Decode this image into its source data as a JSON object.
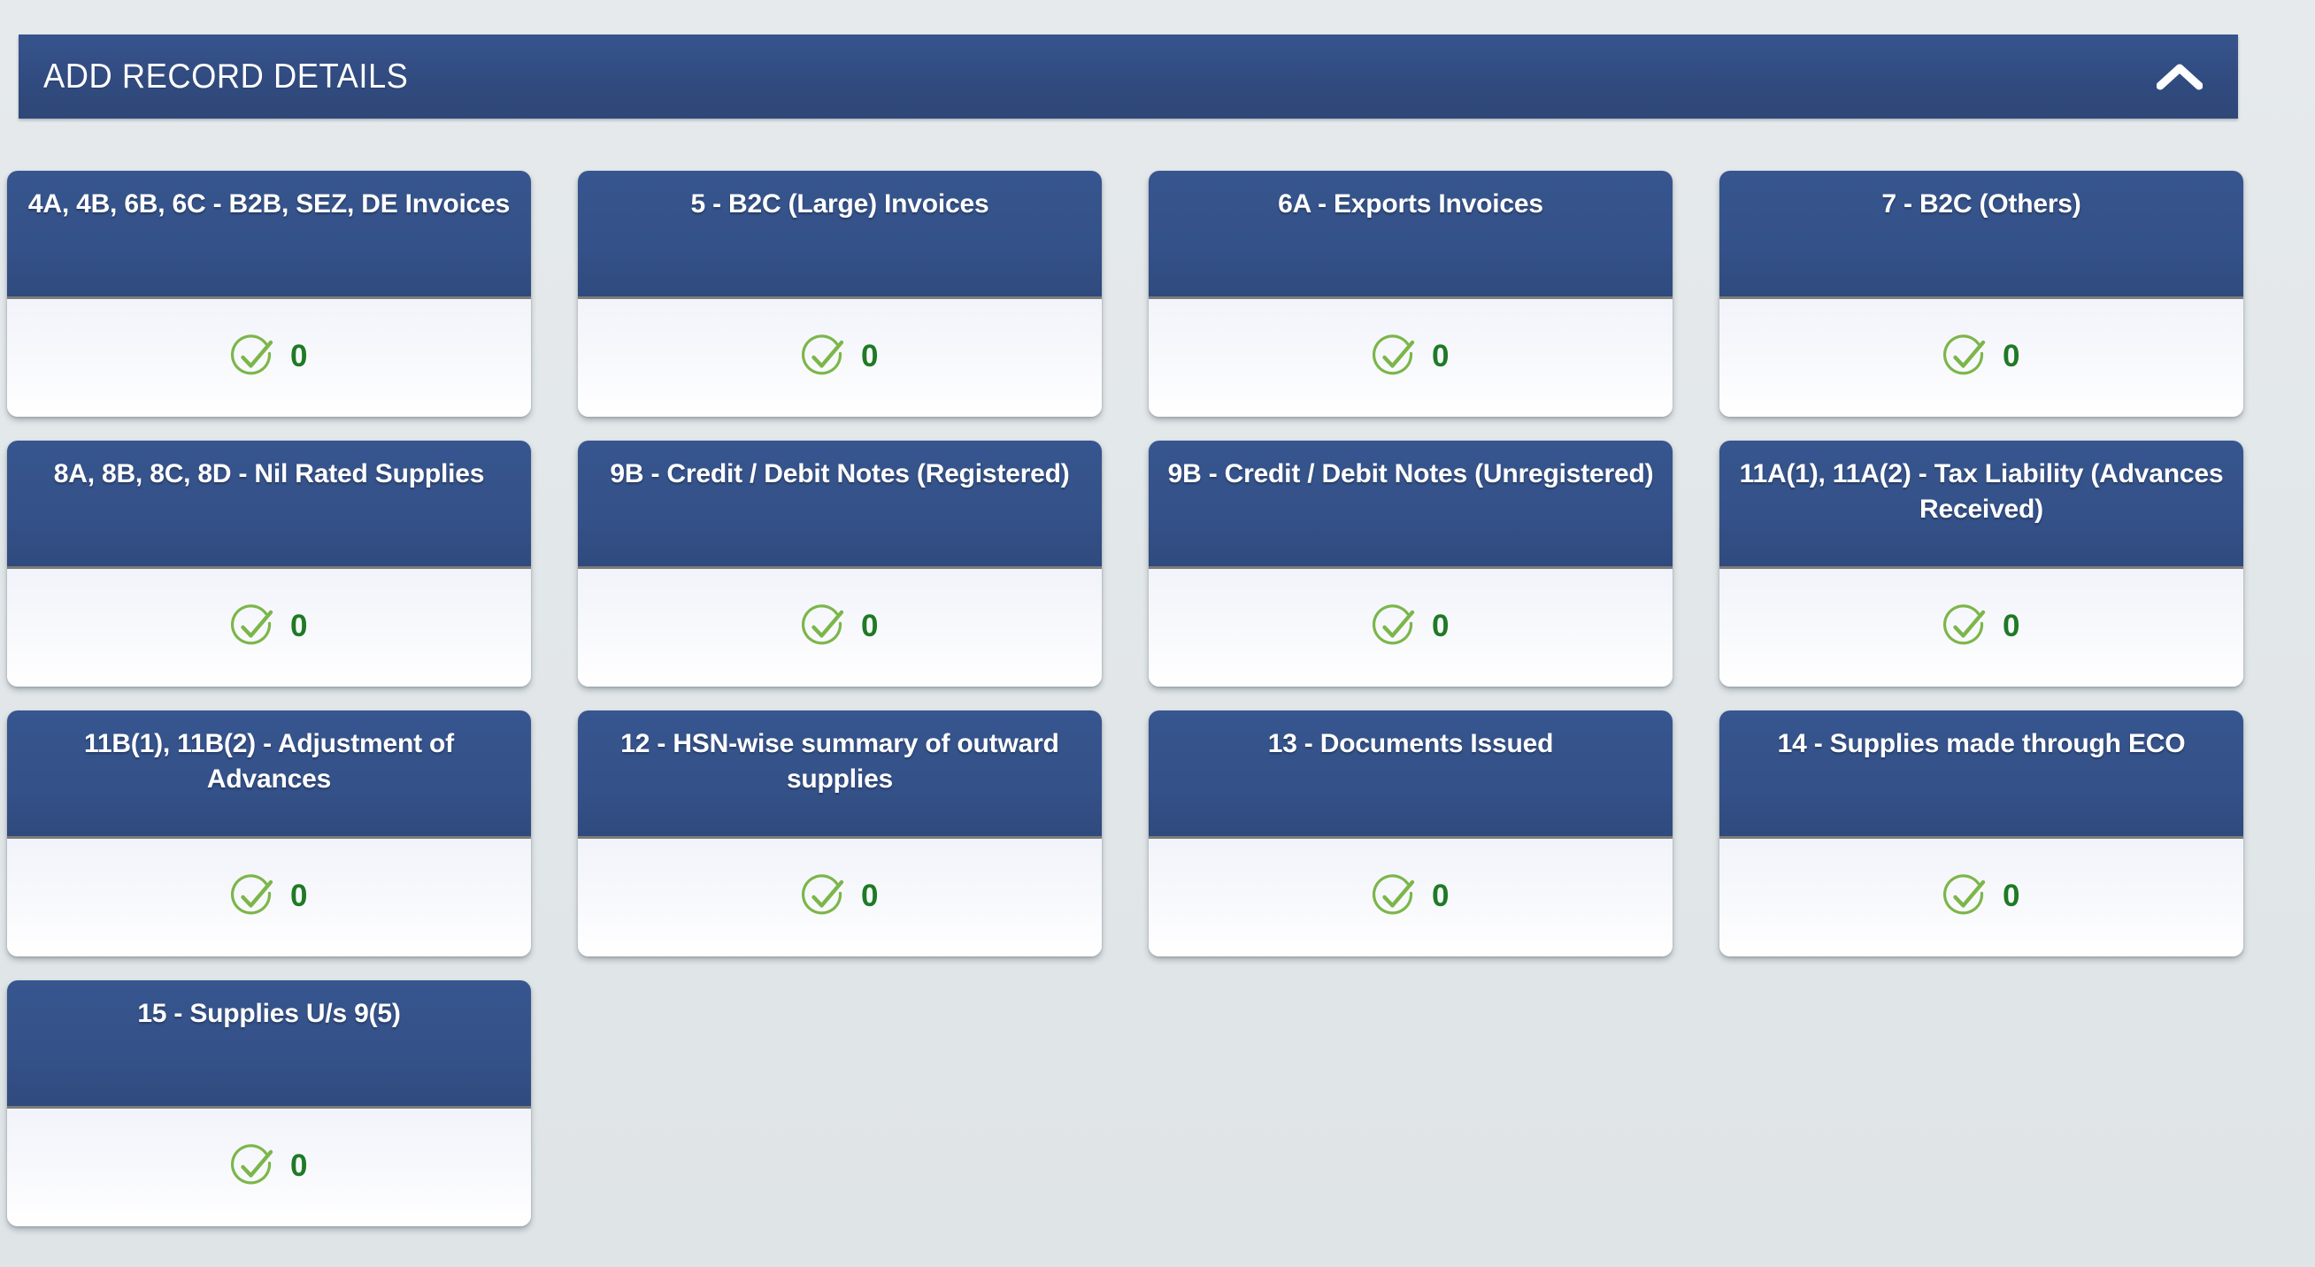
{
  "section": {
    "title": "ADD RECORD DETAILS",
    "collapse_icon": "chevron-up-icon",
    "expanded": true,
    "header_bg": "#33508a",
    "header_text_color": "#ffffff"
  },
  "theme": {
    "page_bg": "#e4e8ea",
    "card_header_bg": "#33508a",
    "card_body_bg": "#f7f8fc",
    "check_icon_color": "#7cb64a",
    "count_color": "#1f7a26"
  },
  "cards": [
    {
      "title": "4A, 4B, 6B, 6C - B2B, SEZ, DE Invoices",
      "count": "0",
      "status_icon": "check-circle-icon"
    },
    {
      "title": "5 - B2C (Large) Invoices",
      "count": "0",
      "status_icon": "check-circle-icon"
    },
    {
      "title": "6A - Exports Invoices",
      "count": "0",
      "status_icon": "check-circle-icon"
    },
    {
      "title": "7 - B2C (Others)",
      "count": "0",
      "status_icon": "check-circle-icon"
    },
    {
      "title": "8A, 8B, 8C, 8D - Nil Rated Supplies",
      "count": "0",
      "status_icon": "check-circle-icon"
    },
    {
      "title": "9B - Credit / Debit Notes (Registered)",
      "count": "0",
      "status_icon": "check-circle-icon"
    },
    {
      "title": "9B - Credit / Debit Notes (Unregistered)",
      "count": "0",
      "status_icon": "check-circle-icon"
    },
    {
      "title": "11A(1), 11A(2) - Tax Liability (Advances Received)",
      "count": "0",
      "status_icon": "check-circle-icon"
    },
    {
      "title": "11B(1), 11B(2) - Adjustment of Advances",
      "count": "0",
      "status_icon": "check-circle-icon"
    },
    {
      "title": "12 - HSN-wise summary of outward supplies",
      "count": "0",
      "status_icon": "check-circle-icon"
    },
    {
      "title": "13 - Documents Issued",
      "count": "0",
      "status_icon": "check-circle-icon"
    },
    {
      "title": "14 - Supplies made through ECO",
      "count": "0",
      "status_icon": "check-circle-icon"
    },
    {
      "title": "15 - Supplies U/s 9(5)",
      "count": "0",
      "status_icon": "check-circle-icon"
    }
  ]
}
